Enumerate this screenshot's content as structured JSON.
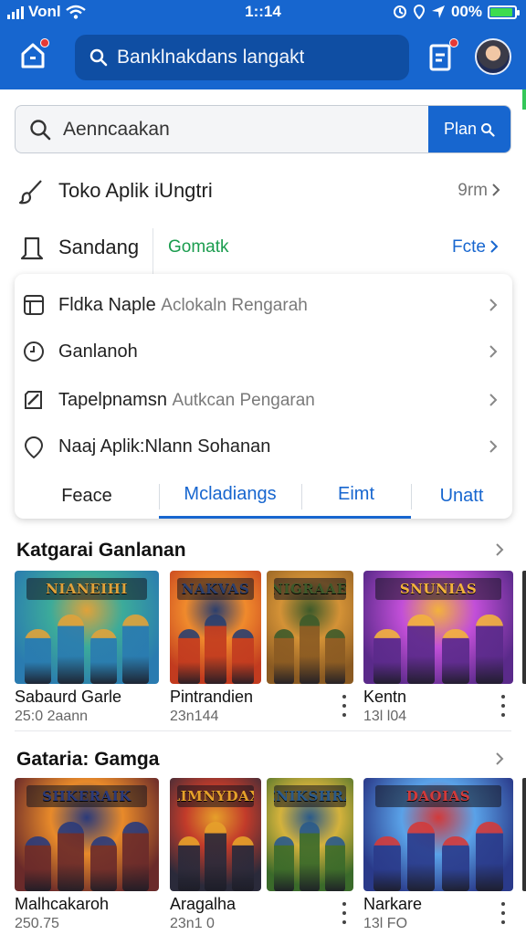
{
  "status_bar": {
    "carrier": "Vonl",
    "time": "1::14",
    "battery": "00%"
  },
  "header": {
    "search_text": "Banklnakdans langakt"
  },
  "search": {
    "placeholder": "Aenncaakan",
    "button_label": "Plan"
  },
  "menu": [
    {
      "label": "Toko Aplik iUngtri",
      "meta": "9rm"
    },
    {
      "label": "Sandang",
      "green": "Gomatk",
      "link": "Fcte"
    }
  ],
  "dropdown": {
    "items": [
      {
        "label": "Fldka Naple",
        "dim": "Aclokaln Rengarah"
      },
      {
        "label": "Ganlanoh",
        "dim": ""
      },
      {
        "label": "Tapelpnamsn",
        "dim": "Autkcan Pengaran"
      },
      {
        "label": "Naaj Aplik:Nlann Sohanan",
        "dim": ""
      }
    ],
    "tabs": [
      "Feace",
      "Mcladiangs",
      "Eimt",
      "Unatt"
    ]
  },
  "sections": [
    {
      "title": "Katgarai Ganlanan",
      "games": [
        {
          "title": "Sabaurd Garle",
          "subtitle": "25:0 2aann",
          "banner": "NIANEIHI",
          "colors": [
            "#2a7bb0",
            "#3cab9a",
            "#e0a23a"
          ]
        },
        {
          "title": "Pintrandien",
          "subtitle": "23n144",
          "banner": "NAKVAS",
          "colors": [
            "#c23b1f",
            "#f08a2c",
            "#2b3f6e"
          ]
        },
        {
          "title": "",
          "subtitle": "",
          "banner": "SNIGRAAEK",
          "colors": [
            "#8a5a22",
            "#d49236",
            "#3d5a2a"
          ]
        },
        {
          "title": "Kentn",
          "subtitle": "13l l04",
          "banner": "SNUNIAS",
          "colors": [
            "#5a2a8a",
            "#c24fd8",
            "#f3b23c"
          ]
        }
      ]
    },
    {
      "title": "Gataria: Gamga",
      "games": [
        {
          "title": "Malhcakaroh",
          "subtitle": "250.75",
          "banner": "SHKERAIK",
          "colors": [
            "#6a2a2a",
            "#e88a2a",
            "#2a3a7a"
          ]
        },
        {
          "title": "Aragalha",
          "subtitle": "23n1 0",
          "banner": "LIMNYDAX",
          "colors": [
            "#2a2a3a",
            "#c23b2a",
            "#e6a02a"
          ]
        },
        {
          "title": "",
          "subtitle": "",
          "banner": "ENIKSHRA",
          "colors": [
            "#3a6a2a",
            "#d4b23c",
            "#2a5a8a"
          ]
        },
        {
          "title": "Narkare",
          "subtitle": "13l FO",
          "banner": "DAOIAS",
          "colors": [
            "#2a3a8a",
            "#5aa2e8",
            "#d23a3a"
          ]
        }
      ]
    }
  ],
  "theme": {
    "primary": "#1766cf",
    "primary_dark": "#0f4ea3",
    "accent_green": "#1a9c4e",
    "badge_red": "#e53935"
  }
}
